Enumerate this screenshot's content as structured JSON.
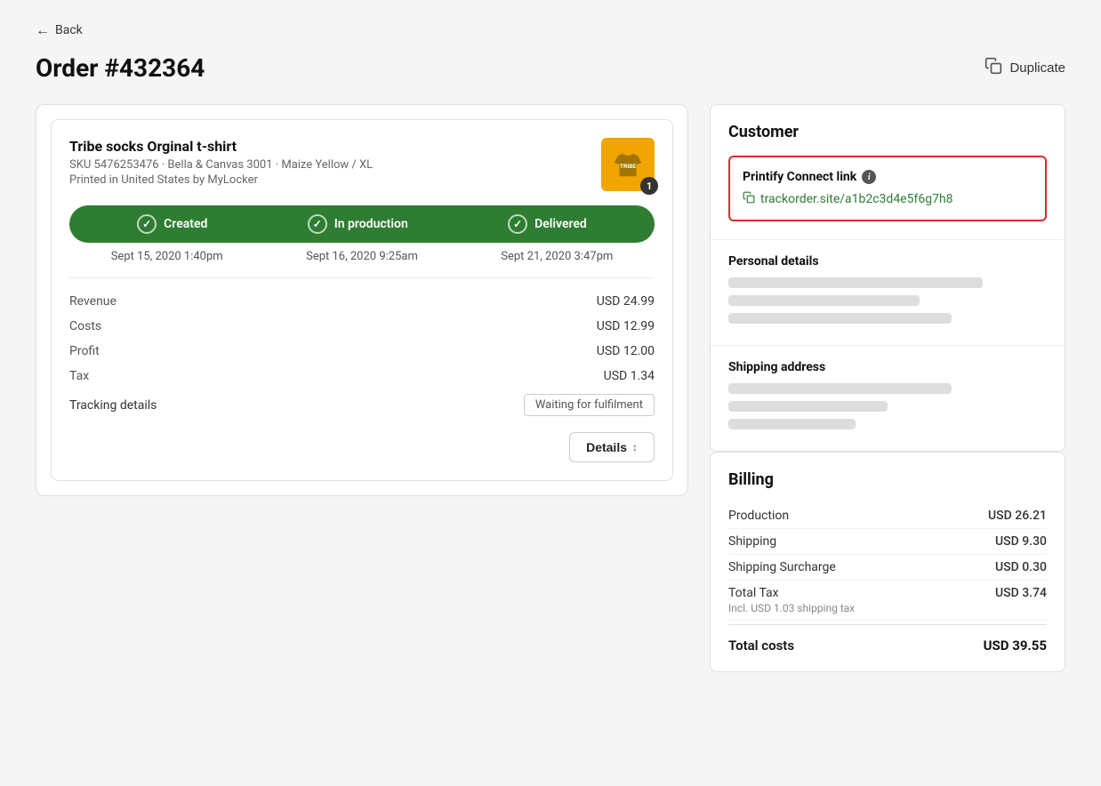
{
  "nav": {
    "back_label": "Back"
  },
  "header": {
    "title": "Order #432364",
    "duplicate_label": "Duplicate"
  },
  "order": {
    "product_name": "Tribe socks Orginal t-shirt",
    "sku": "SKU 5476253476 · Bella & Canvas 3001 · Maize Yellow / XL",
    "printed_by": "Printed in United States by MyLocker",
    "quantity": "1",
    "status_steps": [
      {
        "label": "Created",
        "date": "Sept 15, 2020 1:40pm"
      },
      {
        "label": "In production",
        "date": "Sept 16, 2020 9:25am"
      },
      {
        "label": "Delivered",
        "date": "Sept 21, 2020 3:47pm"
      }
    ],
    "financials": [
      {
        "label": "Revenue",
        "value": "USD 24.99"
      },
      {
        "label": "Costs",
        "value": "USD 12.99"
      },
      {
        "label": "Profit",
        "value": "USD 12.00"
      },
      {
        "label": "Tax",
        "value": "USD 1.34"
      }
    ],
    "tracking_label": "Tracking details",
    "tracking_status": "Waiting for fulfilment",
    "details_btn": "Details"
  },
  "customer": {
    "section_title": "Customer",
    "printify_connect": {
      "label": "Printify Connect link",
      "link": "trackorder.site/a1b2c3d4e5f6g7h8"
    },
    "personal_details_label": "Personal details",
    "shipping_address_label": "Shipping address"
  },
  "billing": {
    "title": "Billing",
    "rows": [
      {
        "label": "Production",
        "value": "USD 26.21",
        "sublabel": ""
      },
      {
        "label": "Shipping",
        "value": "USD 9.30",
        "sublabel": ""
      },
      {
        "label": "Shipping Surcharge",
        "value": "USD 0.30",
        "sublabel": ""
      },
      {
        "label": "Total Tax",
        "value": "USD 3.74",
        "sublabel": "Incl. USD 1.03 shipping tax"
      }
    ],
    "total_label": "Total costs",
    "total_value": "USD 39.55"
  }
}
